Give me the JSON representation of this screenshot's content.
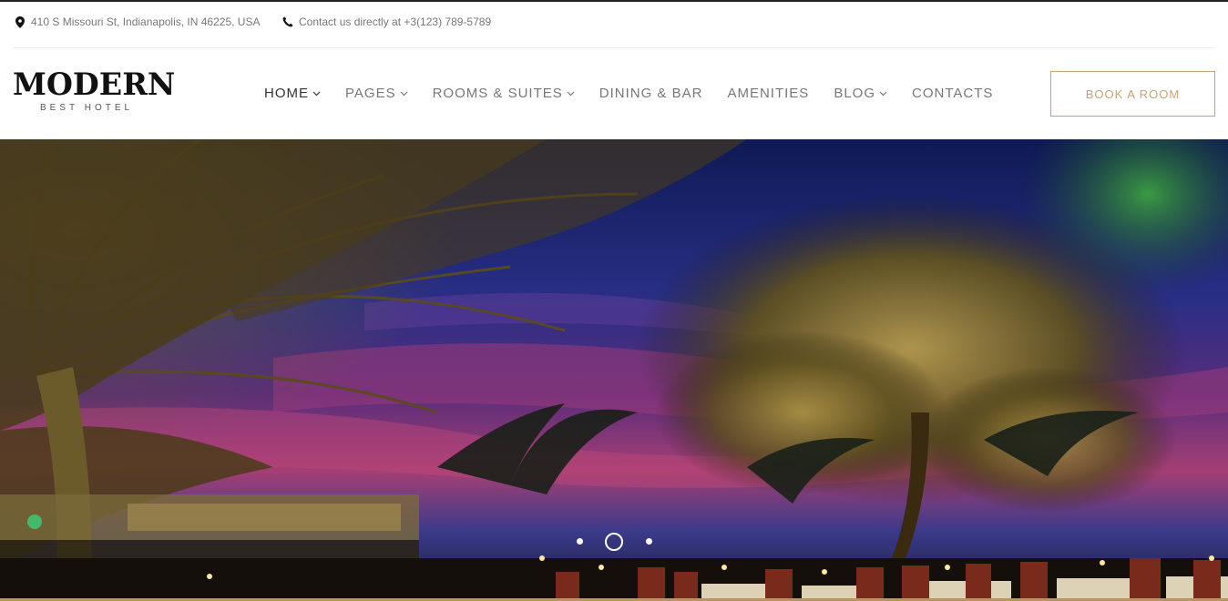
{
  "topbar": {
    "address": "410 S Missouri St, Indianapolis, IN 46225, USA",
    "address_icon": "map-pin-icon",
    "phone": "Contact us directly at +3(123) 789-5789",
    "phone_icon": "phone-icon"
  },
  "logo": {
    "main": "MODERN",
    "sub": "BEST HOTEL"
  },
  "nav": {
    "items": [
      {
        "label": "HOME",
        "dropdown": true,
        "active": true
      },
      {
        "label": "PAGES",
        "dropdown": true
      },
      {
        "label": "ROOMS & SUITES",
        "dropdown": true
      },
      {
        "label": "DINING & BAR",
        "dropdown": false
      },
      {
        "label": "AMENITIES",
        "dropdown": false
      },
      {
        "label": "BLOG",
        "dropdown": true
      },
      {
        "label": "CONTACTS",
        "dropdown": false
      }
    ]
  },
  "cta": {
    "book_label": "BOOK A ROOM"
  },
  "slider": {
    "slide_count": 3,
    "active_index": 1
  },
  "colors": {
    "accent": "#c7a276",
    "text_dark": "#333333",
    "text_muted": "#777777",
    "sky_top": "#1b2a6b",
    "sky_mid": "#5a2c7a",
    "sky_glow": "#b2447a"
  }
}
